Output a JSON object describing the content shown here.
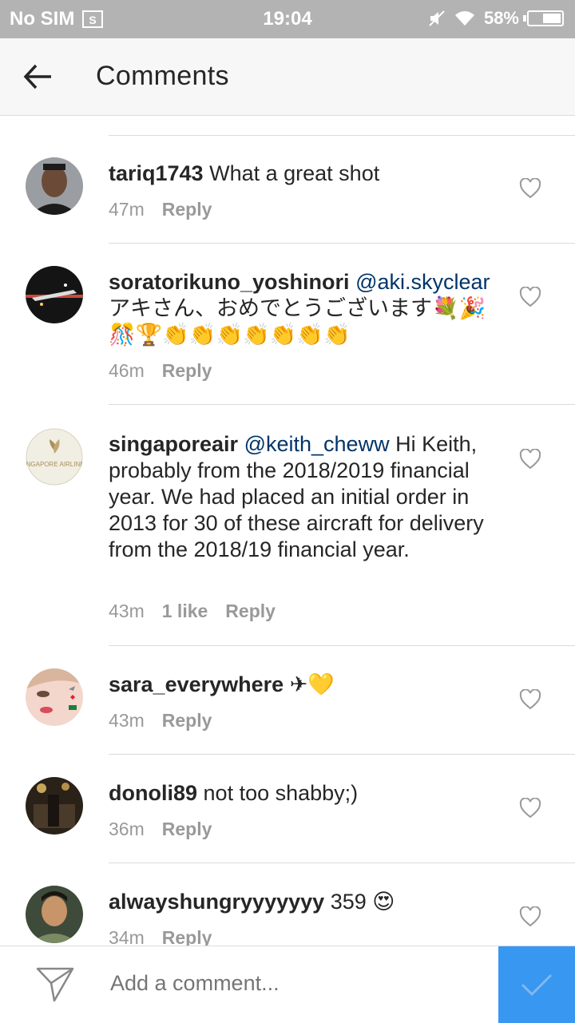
{
  "status_bar": {
    "carrier": "No SIM",
    "time": "19:04",
    "battery": "58%",
    "battery_level": 0.58
  },
  "header": {
    "title": "Comments",
    "back_icon": "arrow-left-icon"
  },
  "comments": [
    {
      "username": "tariq1743",
      "mention": "",
      "text": "What a great shot",
      "time": "47m",
      "likes": "",
      "reply": "Reply"
    },
    {
      "username": "soratorikuno_yoshinori",
      "mention": "@aki.skyclear",
      "text": "アキさん、おめでとうございます💐🎉🎊🏆👏👏👏👏👏👏👏",
      "time": "46m",
      "likes": "",
      "reply": "Reply"
    },
    {
      "username": "singaporeair",
      "mention": "@keith_cheww",
      "text": "Hi Keith, probably from the 2018/2019 financial year. We had placed an initial order in 2013 for 30 of these aircraft for delivery from the 2018/19 financial year.",
      "time": "43m",
      "likes": "1 like",
      "reply": "Reply"
    },
    {
      "username": "sara_everywhere",
      "mention": "",
      "text": "✈💛",
      "time": "43m",
      "likes": "",
      "reply": "Reply"
    },
    {
      "username": "donoli89",
      "mention": "",
      "text": "not too shabby;)",
      "time": "36m",
      "likes": "",
      "reply": "Reply"
    },
    {
      "username": "alwayshungryyyyyyy",
      "mention": "",
      "text": "359 😍",
      "time": "34m",
      "likes": "",
      "reply": "Reply"
    }
  ],
  "avatar_logo_text": "SINGAPORE AIRLINES",
  "composer": {
    "placeholder": "Add a comment...",
    "accent": "#3897f0"
  },
  "colors": {
    "status_bar": "#b3b3b3",
    "mention": "#003569",
    "meta": "#999999"
  }
}
